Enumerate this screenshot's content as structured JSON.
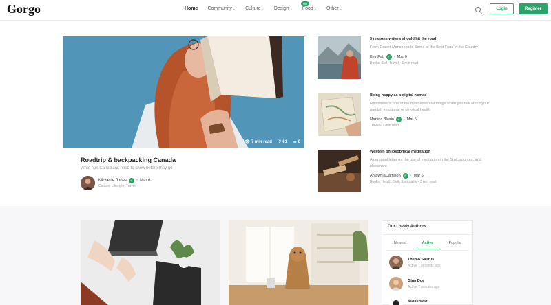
{
  "header": {
    "logo": "Gorgo",
    "nav": [
      {
        "label": "Home",
        "chevron": false,
        "active": true
      },
      {
        "label": "Community",
        "chevron": true
      },
      {
        "label": "Culture",
        "chevron": true
      },
      {
        "label": "Design",
        "chevron": true
      },
      {
        "label": "Food",
        "chevron": true,
        "badge": "Hot"
      },
      {
        "label": "Other",
        "chevron": true
      }
    ],
    "login_label": "Login",
    "register_label": "Register"
  },
  "hero": {
    "title": "Roadtrip & backpacking Canada",
    "subtitle": "What non Canadians need to know before they go",
    "author": "Michellie Jones",
    "date": "Mar 6",
    "tags": "Culture, Lifestyle, Travel",
    "read_time": "7 min read",
    "likes": "61",
    "comments": "0"
  },
  "side_articles": [
    {
      "title": "5 reasons writers should hit the road",
      "desc": "From Desert Monsoons to Some of the Best Food in the Country",
      "author": "Keir Pati",
      "date": "Mar 6",
      "tags": "Books, Self, Travel",
      "read_time": "5 min read"
    },
    {
      "title": "Being happy as a digital nomad",
      "desc": "Happiness is one of the most essential things when you talk about your mental, emotional or physical health",
      "author": "Martina Blasio",
      "date": "Mar 6",
      "tags": "Travel",
      "read_time": "7 min read"
    },
    {
      "title": "Western philosophical meditation",
      "desc": "A personal letter on the use of meditation in the Stoic sources, and elsewhere",
      "author": "Antawnia Jamison",
      "date": "Mar 6",
      "tags": "Books, Health, Self, Spirituality",
      "read_time": "3 min read"
    }
  ],
  "authors_widget": {
    "title": "Our Lovely Authors",
    "tabs": [
      "Newest",
      "Active",
      "Popular"
    ],
    "active_tab": "Active",
    "authors": [
      {
        "name": "Themo Saurus",
        "status": "Active 7 seconds ago"
      },
      {
        "name": "Gina Doe",
        "status": "Active 7 minutes ago"
      },
      {
        "name": "asdasdasd",
        "status": ""
      }
    ]
  },
  "colors": {
    "accent": "#2ea36c",
    "muted_text": "#999999",
    "lower_bg": "#f7f7f9"
  }
}
